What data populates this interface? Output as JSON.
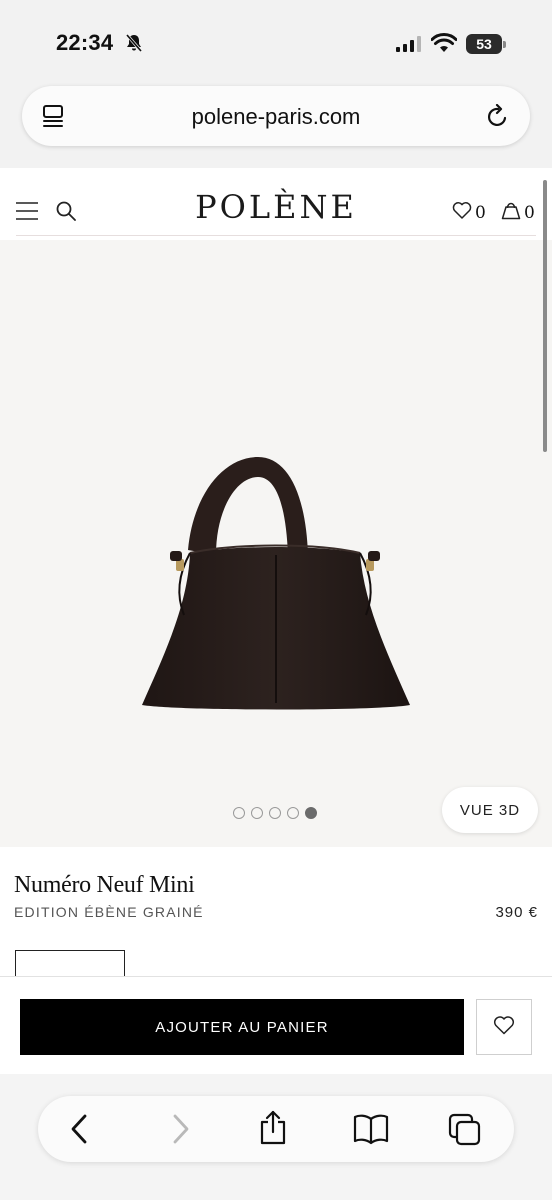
{
  "status_bar": {
    "time": "22:34",
    "battery_level": "53",
    "icons": [
      "bell-slash-icon",
      "signal-icon",
      "wifi-icon",
      "battery-icon"
    ]
  },
  "browser": {
    "url": "polene-paris.com",
    "icons": [
      "tabs-icon",
      "reload-icon"
    ]
  },
  "site_header": {
    "logo": "POLÈNE",
    "wishlist_count": "0",
    "bag_count": "0",
    "icons": [
      "menu-icon",
      "search-icon",
      "heart-icon",
      "bag-icon"
    ]
  },
  "gallery": {
    "image": "handbag-product-image",
    "image_count": 5,
    "active_index": 4,
    "view_3d_label": "VUE 3D"
  },
  "product": {
    "name": "Numéro Neuf Mini",
    "edition": "EDITION ÉBÈNE GRAINÉ",
    "price": "390 €"
  },
  "actions": {
    "add_to_cart_label": "AJOUTER AU PANIER"
  },
  "toolbar": {
    "icons": [
      "back-icon",
      "forward-icon",
      "share-icon",
      "bookmarks-icon",
      "tabs-overview-icon"
    ]
  },
  "colors": {
    "button_bg": "#000000",
    "gallery_bg": "#f6f5f3",
    "bag_color": "#2a1e1b"
  }
}
